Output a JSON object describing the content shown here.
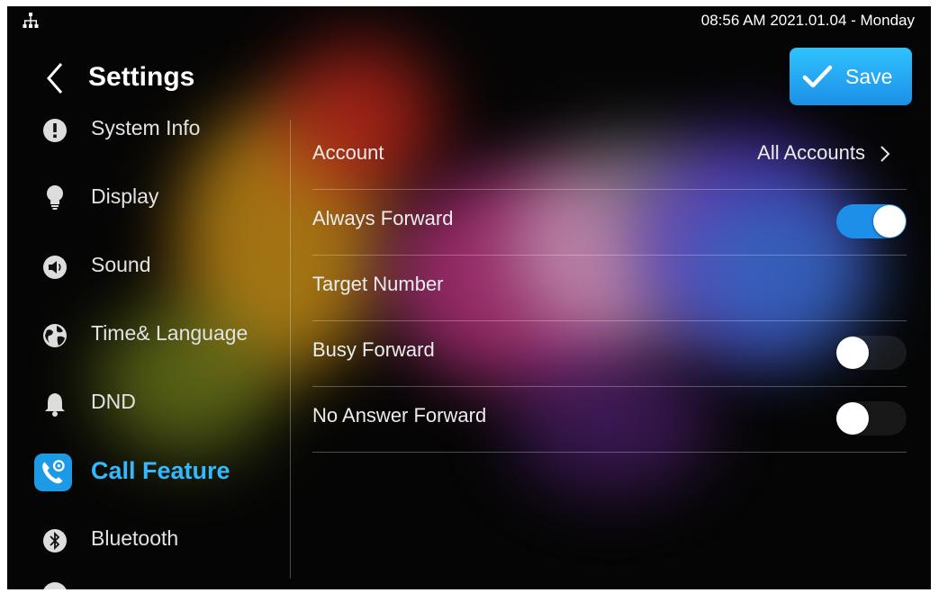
{
  "status_bar": {
    "network_icon": "network-icon",
    "datetime": "08:56 AM  2021.01.04 - Monday"
  },
  "header": {
    "back_icon": "chevron-left-icon",
    "title": "Settings",
    "save_label": "Save",
    "save_icon": "checkmark-icon"
  },
  "sidebar": {
    "items": [
      {
        "label": "System Info",
        "icon": "info-icon",
        "active": false
      },
      {
        "label": "Display",
        "icon": "lightbulb-icon",
        "active": false
      },
      {
        "label": "Sound",
        "icon": "speaker-icon",
        "active": false
      },
      {
        "label": "Time& Language",
        "icon": "globe-icon",
        "active": false
      },
      {
        "label": "DND",
        "icon": "bell-icon",
        "active": false
      },
      {
        "label": "Call Feature",
        "icon": "phone-gear-icon",
        "active": true
      },
      {
        "label": "Bluetooth",
        "icon": "bluetooth-icon",
        "active": false
      }
    ]
  },
  "settings": {
    "account": {
      "label": "Account",
      "value": "All Accounts",
      "icon": "chevron-right-icon"
    },
    "always_forward": {
      "label": "Always Forward",
      "enabled": true
    },
    "target_number": {
      "label": "Target Number"
    },
    "busy_forward": {
      "label": "Busy Forward",
      "enabled": false
    },
    "no_answer_forward": {
      "label": "No Answer Forward",
      "enabled": false
    }
  },
  "colors": {
    "accent": "#34b8ff",
    "toggle_on": "#1e8fe8",
    "background": "#050505"
  }
}
